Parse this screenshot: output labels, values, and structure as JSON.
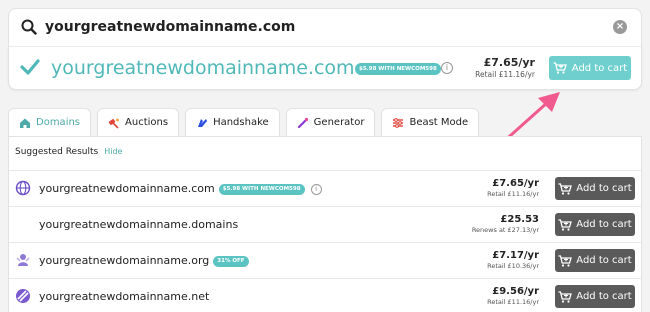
{
  "search": {
    "query": "yourgreatnewdomainname.com",
    "clear_label": "×"
  },
  "featured": {
    "domain": "yourgreatnewdomainname.com",
    "promo": "$5.98 WITH NEWCOM598",
    "price": "£7.65/yr",
    "retail": "Retail £11.16/yr",
    "add_label": "Add to cart",
    "info_label": "i"
  },
  "tabs": [
    {
      "label": "Domains",
      "icon": "home-icon"
    },
    {
      "label": "Auctions",
      "icon": "auction-icon"
    },
    {
      "label": "Handshake",
      "icon": "handshake-icon"
    },
    {
      "label": "Generator",
      "icon": "generator-icon"
    },
    {
      "label": "Beast Mode",
      "icon": "beast-mode-icon"
    }
  ],
  "results": {
    "header": "Suggested Results",
    "hide_label": "Hide",
    "rows": [
      {
        "domain": "yourgreatnewdomainname.com",
        "badge": "$5.98 WITH NEWCOM598",
        "price": "£7.65/yr",
        "sub": "Retail £11.16/yr",
        "add_label": "Add to cart",
        "icon": "globe-icon"
      },
      {
        "domain": "yourgreatnewdomainname.domains",
        "badge": "",
        "price": "£25.53",
        "sub": "Renews at £27.13/yr",
        "add_label": "Add to cart",
        "icon": ""
      },
      {
        "domain": "yourgreatnewdomainname.org",
        "badge": "31% OFF",
        "price": "£7.17/yr",
        "sub": "Retail £10.36/yr",
        "add_label": "Add to cart",
        "icon": "org-icon"
      },
      {
        "domain": "yourgreatnewdomainname.net",
        "badge": "",
        "price": "£9.56/yr",
        "sub": "Retail £11.16/yr",
        "add_label": "Add to cart",
        "icon": "net-icon"
      }
    ]
  },
  "colors": {
    "accent": "#5cc3c3",
    "dark_button": "#5a5a5a",
    "arrow": "#f05a8e"
  }
}
